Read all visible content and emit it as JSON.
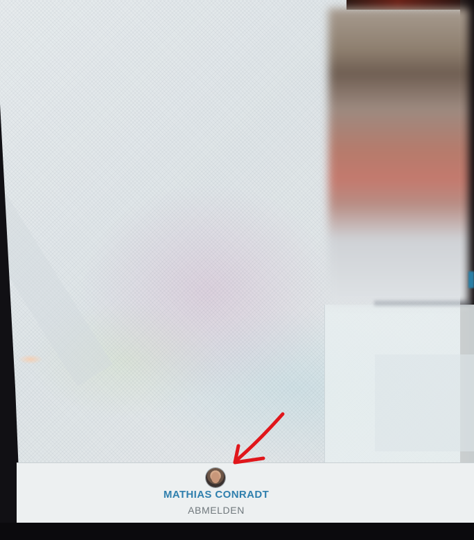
{
  "user_menu": {
    "user_name": "MATHIAS CONRADT",
    "logout_label": "ABMELDEN"
  },
  "annotation": {
    "arrow_color": "#e0161b"
  },
  "colors": {
    "accent": "#2f7fad",
    "muted_text": "#6f777c",
    "footer_bg": "#edf0f1"
  },
  "icons": {
    "avatar": "user-avatar-photo",
    "arrow": "red-hand-drawn-arrow"
  }
}
